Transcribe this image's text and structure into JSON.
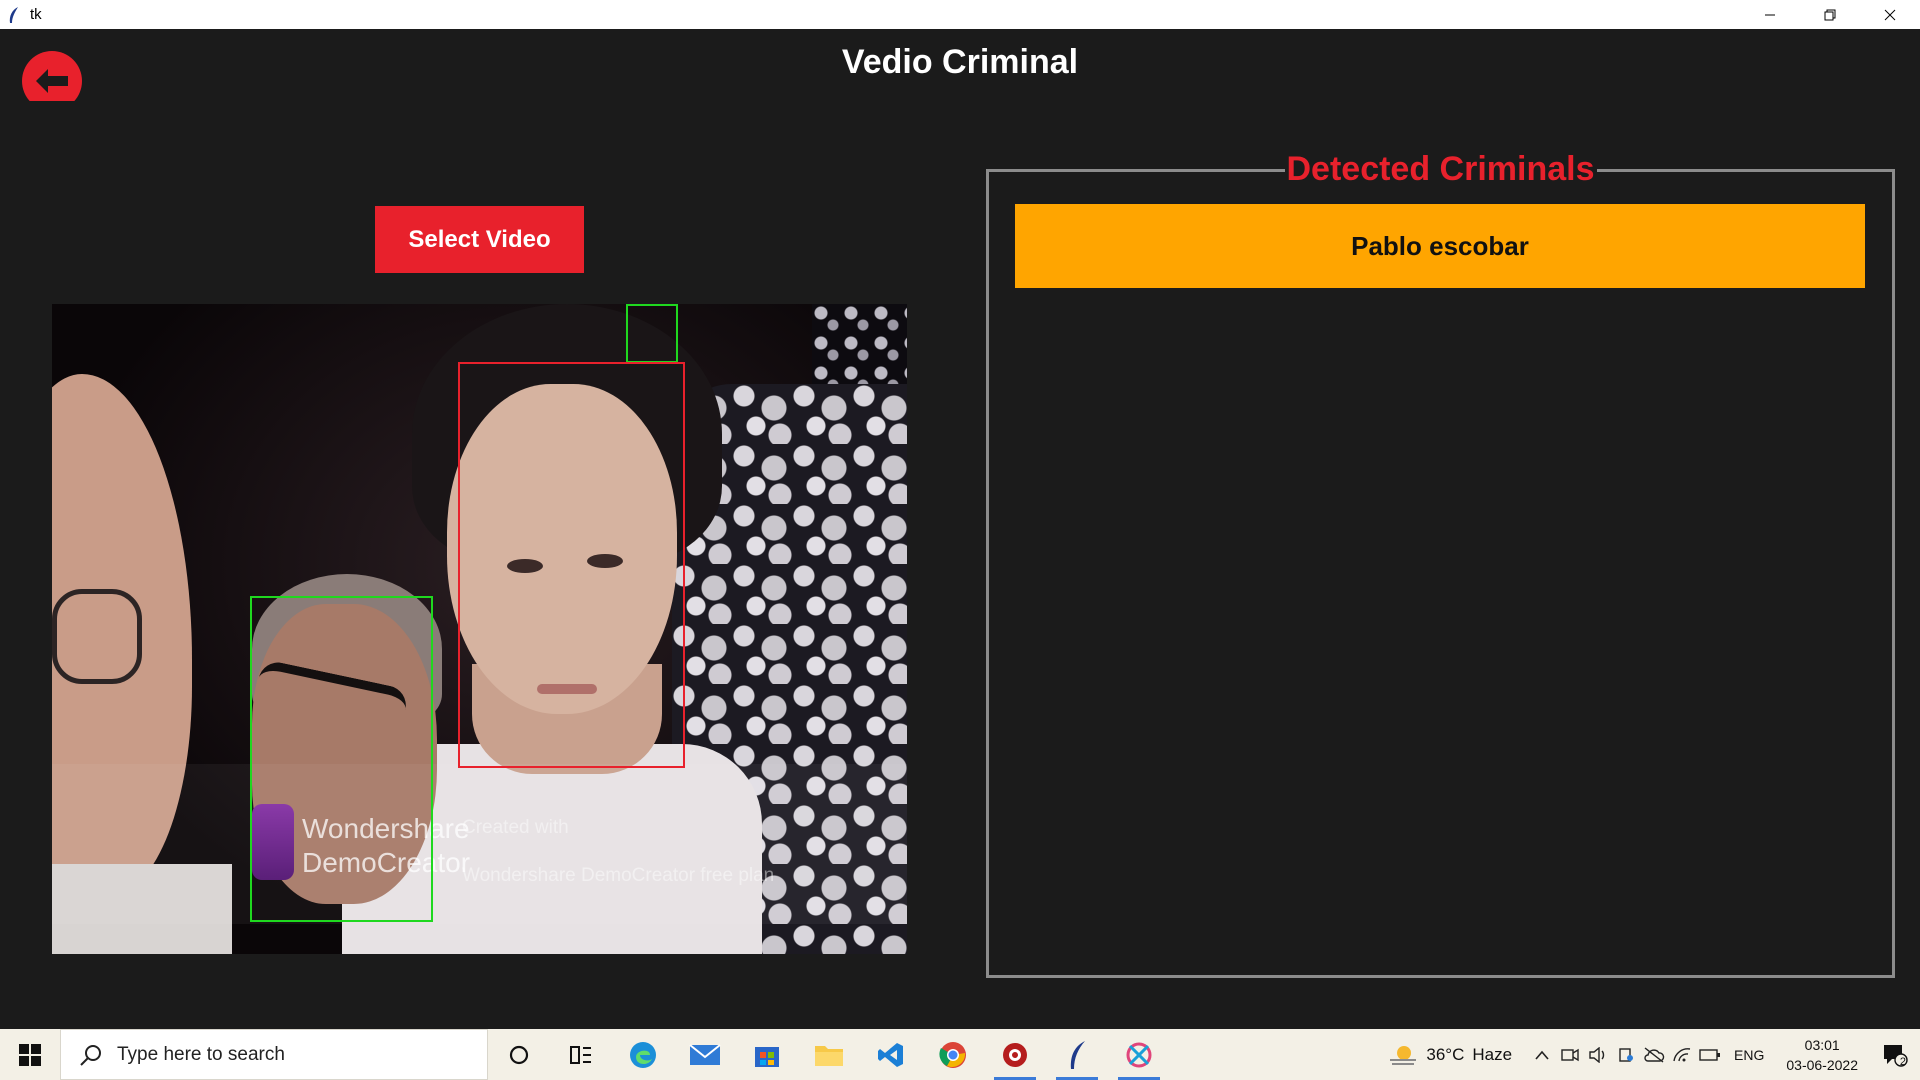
{
  "window": {
    "title": "tk",
    "controls": {
      "minimize": "minimize-icon",
      "restore": "restore-icon",
      "close": "close-icon"
    }
  },
  "app": {
    "title": "Vedio Criminal",
    "back_icon": "back-arrow-icon",
    "select_button": "Select Video",
    "video": {
      "watermark_brand_line1": "Wondershare",
      "watermark_brand_line2": "DemoCreator",
      "watermark_created": "Created with",
      "watermark_plan": "Wondershare DemoCreator free plan"
    },
    "detected_panel": {
      "title": "Detected Criminals",
      "items": [
        "Pablo escobar"
      ]
    }
  },
  "colors": {
    "background": "#1b1b1b",
    "accent_red": "#e8212c",
    "item_orange": "#ffa500",
    "box_green": "#1fd81f"
  },
  "taskbar": {
    "search_placeholder": "Type here to search",
    "weather_temp": "36°C",
    "weather_desc": "Haze",
    "language": "ENG",
    "time": "03:01",
    "date": "03-06-2022",
    "notification_count": "2",
    "apps": [
      "cortana-icon",
      "task-view-icon",
      "edge-icon",
      "mail-icon",
      "store-icon",
      "file-explorer-icon",
      "vscode-icon",
      "chrome-icon",
      "app-red-icon",
      "python-tk-icon",
      "snip-icon"
    ]
  }
}
